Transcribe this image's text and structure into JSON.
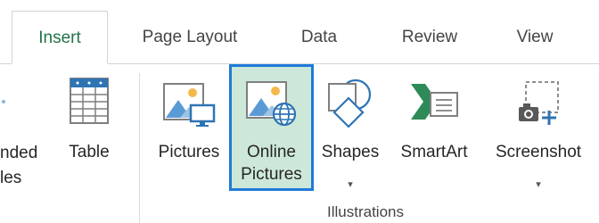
{
  "tabs": [
    {
      "label": "Insert",
      "active": true
    },
    {
      "label": "Page Layout",
      "active": false
    },
    {
      "label": "Data",
      "active": false
    },
    {
      "label": "Review",
      "active": false
    },
    {
      "label": "View",
      "active": false
    }
  ],
  "left_partial": {
    "line1": "nded",
    "line2": "les"
  },
  "buttons": {
    "table": {
      "label": "Table",
      "icon": "table-icon"
    },
    "pictures": {
      "label": "Pictures",
      "icon": "pictures-icon"
    },
    "online_pictures": {
      "label": "Online",
      "label2": "Pictures",
      "icon": "online-pictures-icon",
      "selected": true
    },
    "shapes": {
      "label": "Shapes",
      "dropdown": "▾",
      "icon": "shapes-icon"
    },
    "smartart": {
      "label": "SmartArt",
      "icon": "smartart-icon"
    },
    "screenshot": {
      "label": "Screenshot",
      "dropdown": "▾",
      "icon": "screenshot-icon"
    }
  },
  "group_label": "Illustrations",
  "colors": {
    "accent_green": "#217346",
    "selection_border": "#1e7bd9",
    "selection_fill": "#cde8d8"
  }
}
